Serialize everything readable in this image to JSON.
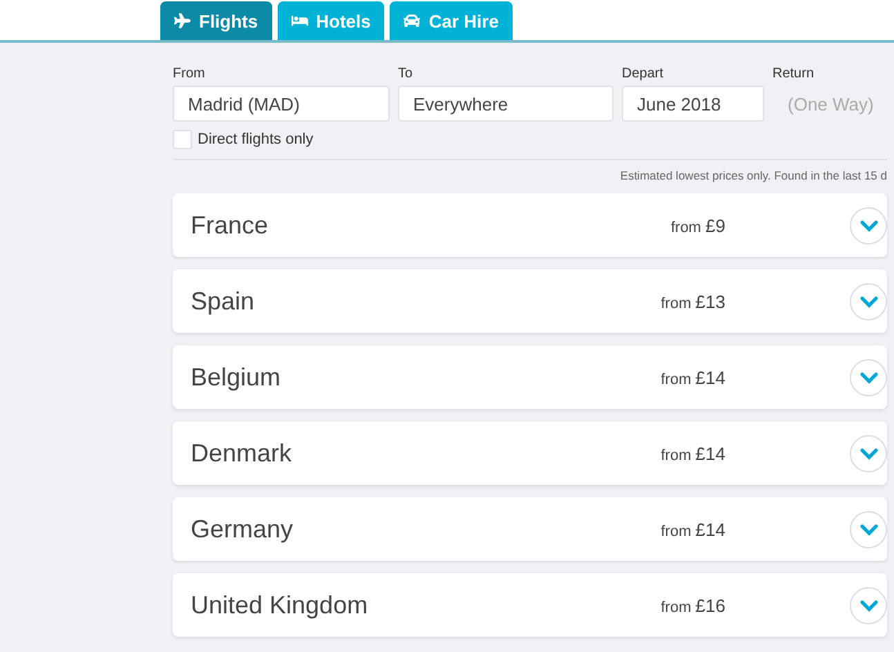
{
  "tabs": [
    {
      "label": "Flights",
      "selected": true
    },
    {
      "label": "Hotels",
      "selected": false
    },
    {
      "label": "Car Hire",
      "selected": false
    }
  ],
  "search": {
    "from": {
      "label": "From",
      "value": "Madrid (MAD)"
    },
    "to": {
      "label": "To",
      "value": "Everywhere"
    },
    "depart": {
      "label": "Depart",
      "value": "June 2018"
    },
    "return": {
      "label": "Return",
      "placeholder": "(One Way)"
    },
    "direct_only": {
      "label": "Direct flights only",
      "checked": false
    }
  },
  "note": "Estimated lowest prices only. Found in the last 15 d",
  "results": [
    {
      "country": "France",
      "prefix": "from",
      "price": "£9"
    },
    {
      "country": "Spain",
      "prefix": "from",
      "price": "£13"
    },
    {
      "country": "Belgium",
      "prefix": "from",
      "price": "£14"
    },
    {
      "country": "Denmark",
      "prefix": "from",
      "price": "£14"
    },
    {
      "country": "Germany",
      "prefix": "from",
      "price": "£14"
    },
    {
      "country": "United Kingdom",
      "prefix": "from",
      "price": "£16"
    }
  ]
}
